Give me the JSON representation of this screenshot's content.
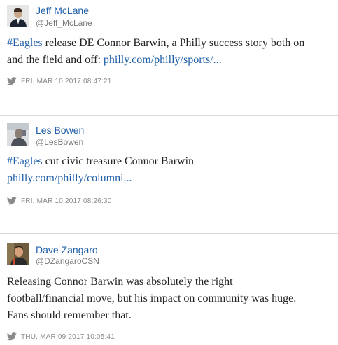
{
  "tweets": [
    {
      "name": "Jeff McLane",
      "handle": "@Jeff_McLane",
      "hashtag": "#Eagles",
      "line1_rest": " release DE Connor Barwin, a Philly success story both on",
      "line2_text": "and the field and off: ",
      "link": "philly.com/philly/sports/...",
      "timestamp": "FRI, MAR 10 2017 08:47:21",
      "icon": "twitter-bird-icon"
    },
    {
      "name": "Les Bowen",
      "handle": "@LesBowen",
      "hashtag": "#Eagles",
      "line1_rest": " cut civic treasure Connor Barwin",
      "link": "philly.com/philly/columni...",
      "timestamp": "FRI, MAR 10 2017 08:26:30",
      "icon": "twitter-bird-icon"
    },
    {
      "name": "Dave Zangaro",
      "handle": "@DZangaroCSN",
      "line1": "Releasing Connor Barwin was absolutely the right",
      "line2": "football/financial move, but his impact on community was huge.",
      "line3": "Fans should remember that.",
      "timestamp": "THU, MAR 09 2017 10:05:41",
      "icon": "twitter-bird-icon"
    }
  ],
  "colors": {
    "link": "#1f5fa8",
    "timestamp": "#8a8a8a",
    "divider": "#d8d8d8"
  }
}
